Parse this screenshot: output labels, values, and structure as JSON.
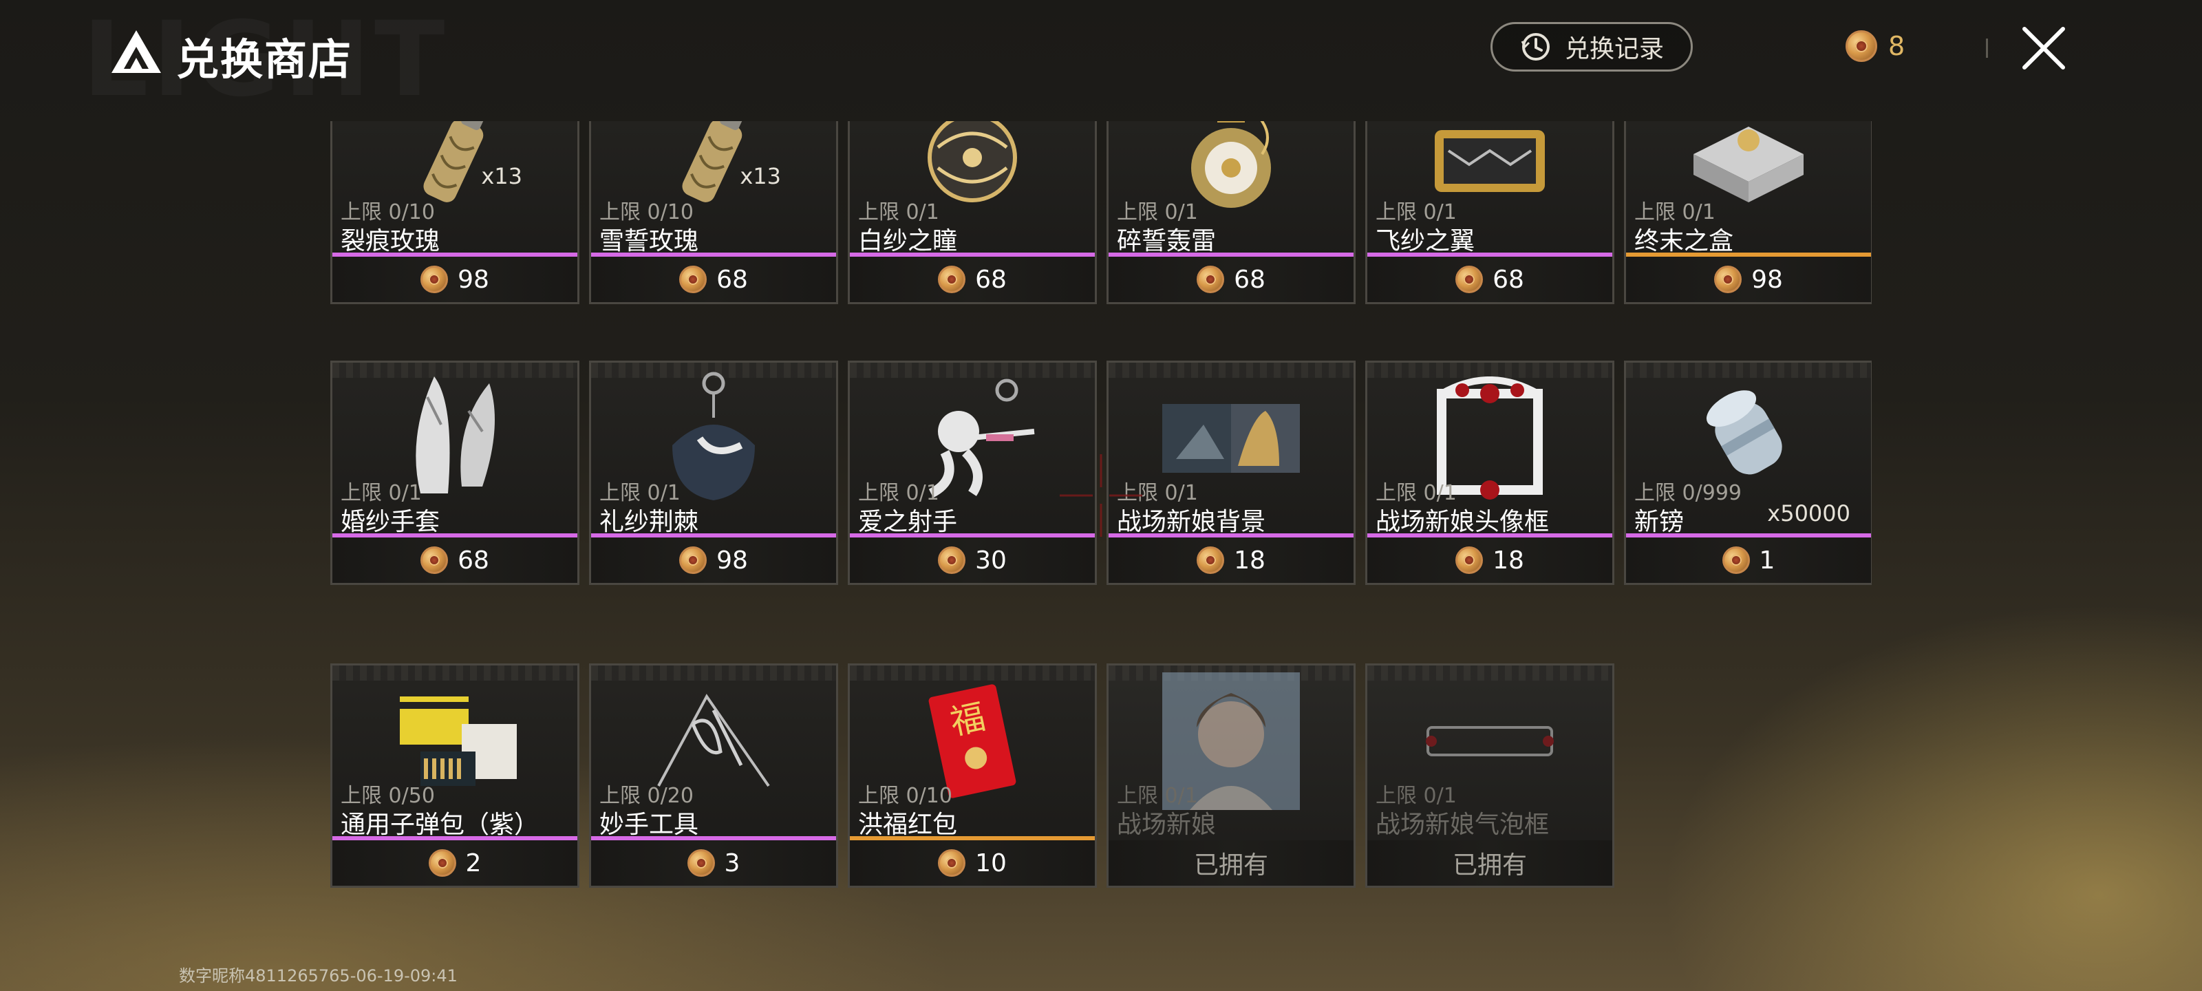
{
  "header": {
    "title": "兑换商店",
    "watermark": "LIGHT",
    "history_label": "兑换记录",
    "currency_amount": "8"
  },
  "items": [
    {
      "name": "裂痕玫瑰",
      "limit": "上限 0/10",
      "price": "98",
      "qty": "x13",
      "rarity": "purple",
      "icon": "canister-icon",
      "owned": false
    },
    {
      "name": "雪誓玫瑰",
      "limit": "上限 0/10",
      "price": "68",
      "qty": "x13",
      "rarity": "purple",
      "icon": "canister-icon",
      "owned": false
    },
    {
      "name": "白纱之瞳",
      "limit": "上限 0/1",
      "price": "68",
      "qty": "",
      "rarity": "purple",
      "icon": "orb-icon",
      "owned": false
    },
    {
      "name": "碎誓轰雷",
      "limit": "上限 0/1",
      "price": "68",
      "qty": "",
      "rarity": "purple",
      "icon": "grenade-icon",
      "owned": false
    },
    {
      "name": "飞纱之翼",
      "limit": "上限 0/1",
      "price": "68",
      "qty": "",
      "rarity": "purple",
      "icon": "glider-icon",
      "owned": false
    },
    {
      "name": "终末之盒",
      "limit": "上限 0/1",
      "price": "98",
      "qty": "",
      "rarity": "gold",
      "icon": "box-icon",
      "owned": false
    },
    {
      "name": "婚纱手套",
      "limit": "上限 0/1",
      "price": "68",
      "qty": "",
      "rarity": "purple",
      "icon": "gloves-icon",
      "owned": false
    },
    {
      "name": "礼纱荆棘",
      "limit": "上限 0/1",
      "price": "98",
      "qty": "",
      "rarity": "purple",
      "icon": "charm-icon",
      "owned": false
    },
    {
      "name": "爱之射手",
      "limit": "上限 0/1",
      "price": "30",
      "qty": "",
      "rarity": "purple",
      "icon": "cupid-icon",
      "owned": false
    },
    {
      "name": "战场新娘背景",
      "limit": "上限 0/1",
      "price": "18",
      "qty": "",
      "rarity": "purple",
      "icon": "background-icon",
      "owned": false
    },
    {
      "name": "战场新娘头像框",
      "limit": "上限 0/1",
      "price": "18",
      "qty": "",
      "rarity": "purple",
      "icon": "frame-icon",
      "owned": false
    },
    {
      "name": "新镑",
      "limit": "上限 0/999",
      "price": "1",
      "qty": "x50000",
      "rarity": "purple",
      "icon": "cash-roll-icon",
      "owned": false
    },
    {
      "name": "通用子弹包（紫）",
      "limit": "上限 0/50",
      "price": "2",
      "qty": "",
      "rarity": "purple",
      "icon": "ammo-box-icon",
      "owned": false
    },
    {
      "name": "妙手工具",
      "limit": "上限 0/20",
      "price": "3",
      "qty": "",
      "rarity": "purple",
      "icon": "paperclip-icon",
      "owned": false
    },
    {
      "name": "洪福红包",
      "limit": "上限 0/10",
      "price": "10",
      "qty": "",
      "rarity": "gold",
      "icon": "red-envelope-icon",
      "owned": false
    },
    {
      "name": "战场新娘",
      "limit": "上限 0/1",
      "price": "",
      "qty": "",
      "rarity": "none",
      "icon": "portrait-icon",
      "owned": true,
      "owned_label": "已拥有"
    },
    {
      "name": "战场新娘气泡框",
      "limit": "上限 0/1",
      "price": "",
      "qty": "",
      "rarity": "none",
      "icon": "bubble-frame-icon",
      "owned": true,
      "owned_label": "已拥有"
    }
  ],
  "footer": {
    "player_id": "数字昵称4811265765-06-19-09:41"
  },
  "colors": {
    "purple": "#d66ae6",
    "gold": "#e59a33",
    "coin": "#d99a4a"
  }
}
